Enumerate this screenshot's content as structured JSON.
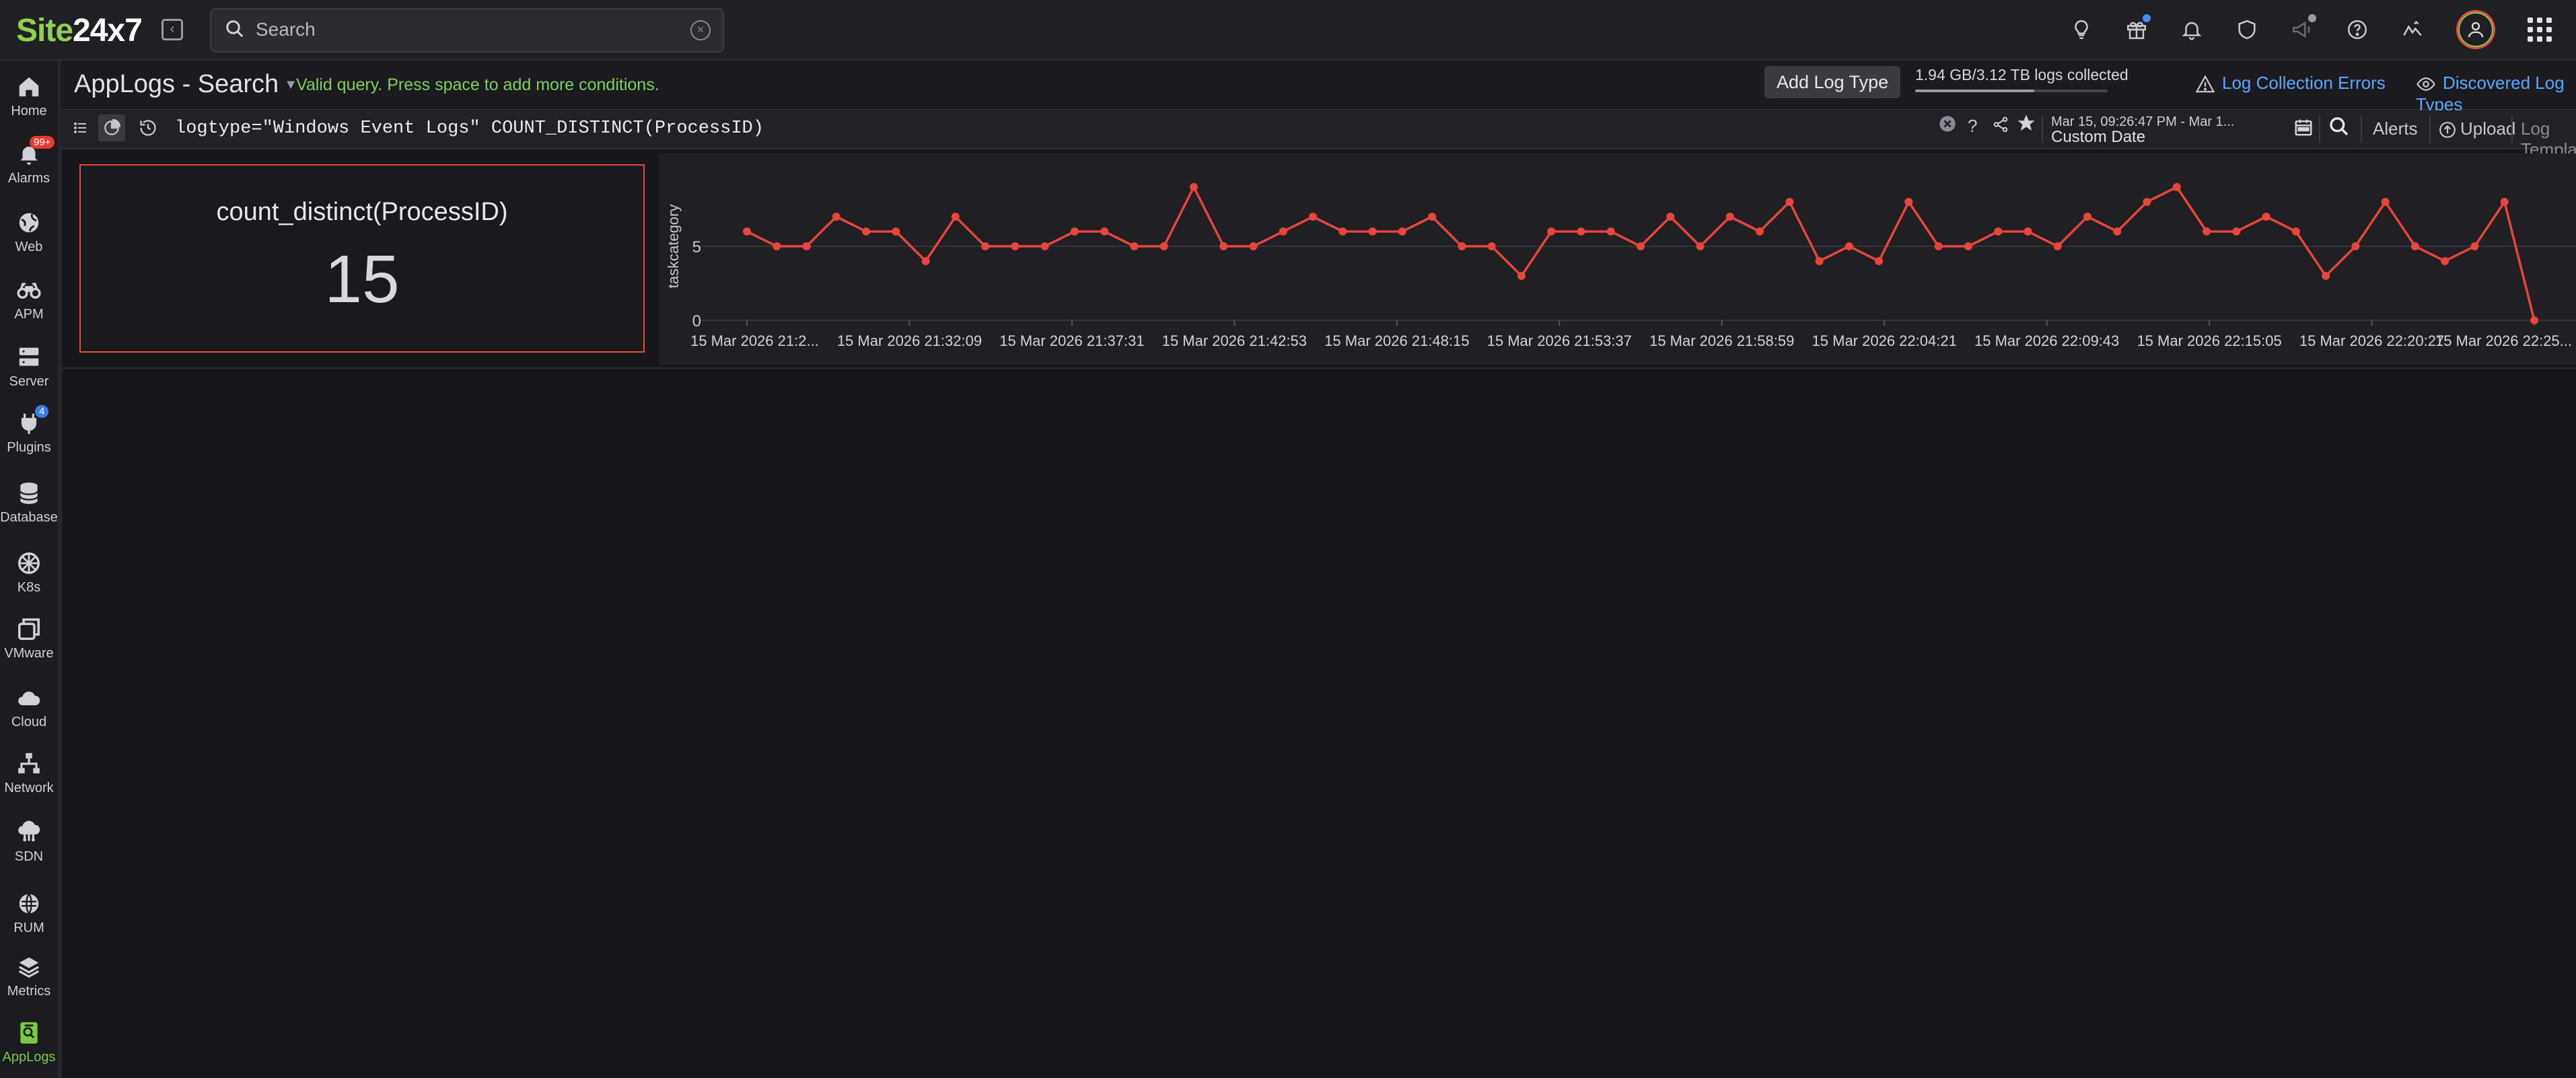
{
  "app": {
    "logo_prefix": "Site",
    "logo_suffix": "24x7",
    "search_placeholder": "Search"
  },
  "sidebar": {
    "items": [
      {
        "label": "Home",
        "icon": "home-icon"
      },
      {
        "label": "Alarms",
        "icon": "bell-icon",
        "badge": "99+"
      },
      {
        "label": "Web",
        "icon": "globe-icon"
      },
      {
        "label": "APM",
        "icon": "binoculars-icon"
      },
      {
        "label": "Server",
        "icon": "server-icon"
      },
      {
        "label": "Plugins",
        "icon": "plug-icon",
        "badge": "4"
      },
      {
        "label": "Database",
        "icon": "database-icon"
      },
      {
        "label": "K8s",
        "icon": "helm-icon"
      },
      {
        "label": "VMware",
        "icon": "vmware-icon"
      },
      {
        "label": "Cloud",
        "icon": "cloud-icon"
      },
      {
        "label": "Network",
        "icon": "network-icon"
      },
      {
        "label": "SDN",
        "icon": "sdn-icon"
      },
      {
        "label": "RUM",
        "icon": "rum-icon"
      },
      {
        "label": "Metrics",
        "icon": "layers-icon"
      },
      {
        "label": "AppLogs",
        "icon": "applogs-icon",
        "active": true
      }
    ]
  },
  "subheader": {
    "title": "AppLogs - Search",
    "status": "Valid query. Press space to add more conditions.",
    "add_log_type": "Add Log Type",
    "collected": "1.94 GB/3.12 TB logs collected",
    "collected_fraction": 0.62,
    "log_collection_errors": "Log Collection Errors",
    "discovered_log_types": "Discovered Log Types"
  },
  "query": {
    "value": "logtype=\"Windows Event Logs\" COUNT_DISTINCT(ProcessID)",
    "help": "?",
    "date_range": "Mar 15, 09:26:47 PM - Mar 1...",
    "date_label": "Custom Date",
    "alerts": "Alerts",
    "upload": "Upload",
    "log_templates": "Log Templates"
  },
  "widget": {
    "label": "count_distinct(ProcessID)",
    "value": "15"
  },
  "chart_data": {
    "type": "line",
    "ylabel": "taskcategory",
    "ylim": [
      0,
      10
    ],
    "yticks": [
      0,
      5
    ],
    "color": "#e8453c",
    "xtick_labels": [
      "15 Mar 2026 21:2...",
      "15 Mar 2026 21:32:09",
      "15 Mar 2026 21:37:31",
      "15 Mar 2026 21:42:53",
      "15 Mar 2026 21:48:15",
      "15 Mar 2026 21:53:37",
      "15 Mar 2026 21:58:59",
      "15 Mar 2026 22:04:21",
      "15 Mar 2026 22:09:43",
      "15 Mar 2026 22:15:05",
      "15 Mar 2026 22:20:27",
      "15 Mar 2026 22:25..."
    ],
    "values": [
      6,
      5,
      5,
      7,
      6,
      6,
      4,
      7,
      5,
      5,
      5,
      6,
      6,
      5,
      5,
      9,
      5,
      5,
      6,
      7,
      6,
      6,
      6,
      7,
      5,
      5,
      3,
      6,
      6,
      6,
      5,
      7,
      5,
      7,
      6,
      8,
      4,
      5,
      4,
      8,
      5,
      5,
      6,
      6,
      5,
      7,
      6,
      8,
      9,
      6,
      6,
      7,
      6,
      3,
      5,
      8,
      5,
      4,
      5,
      8,
      0
    ]
  }
}
